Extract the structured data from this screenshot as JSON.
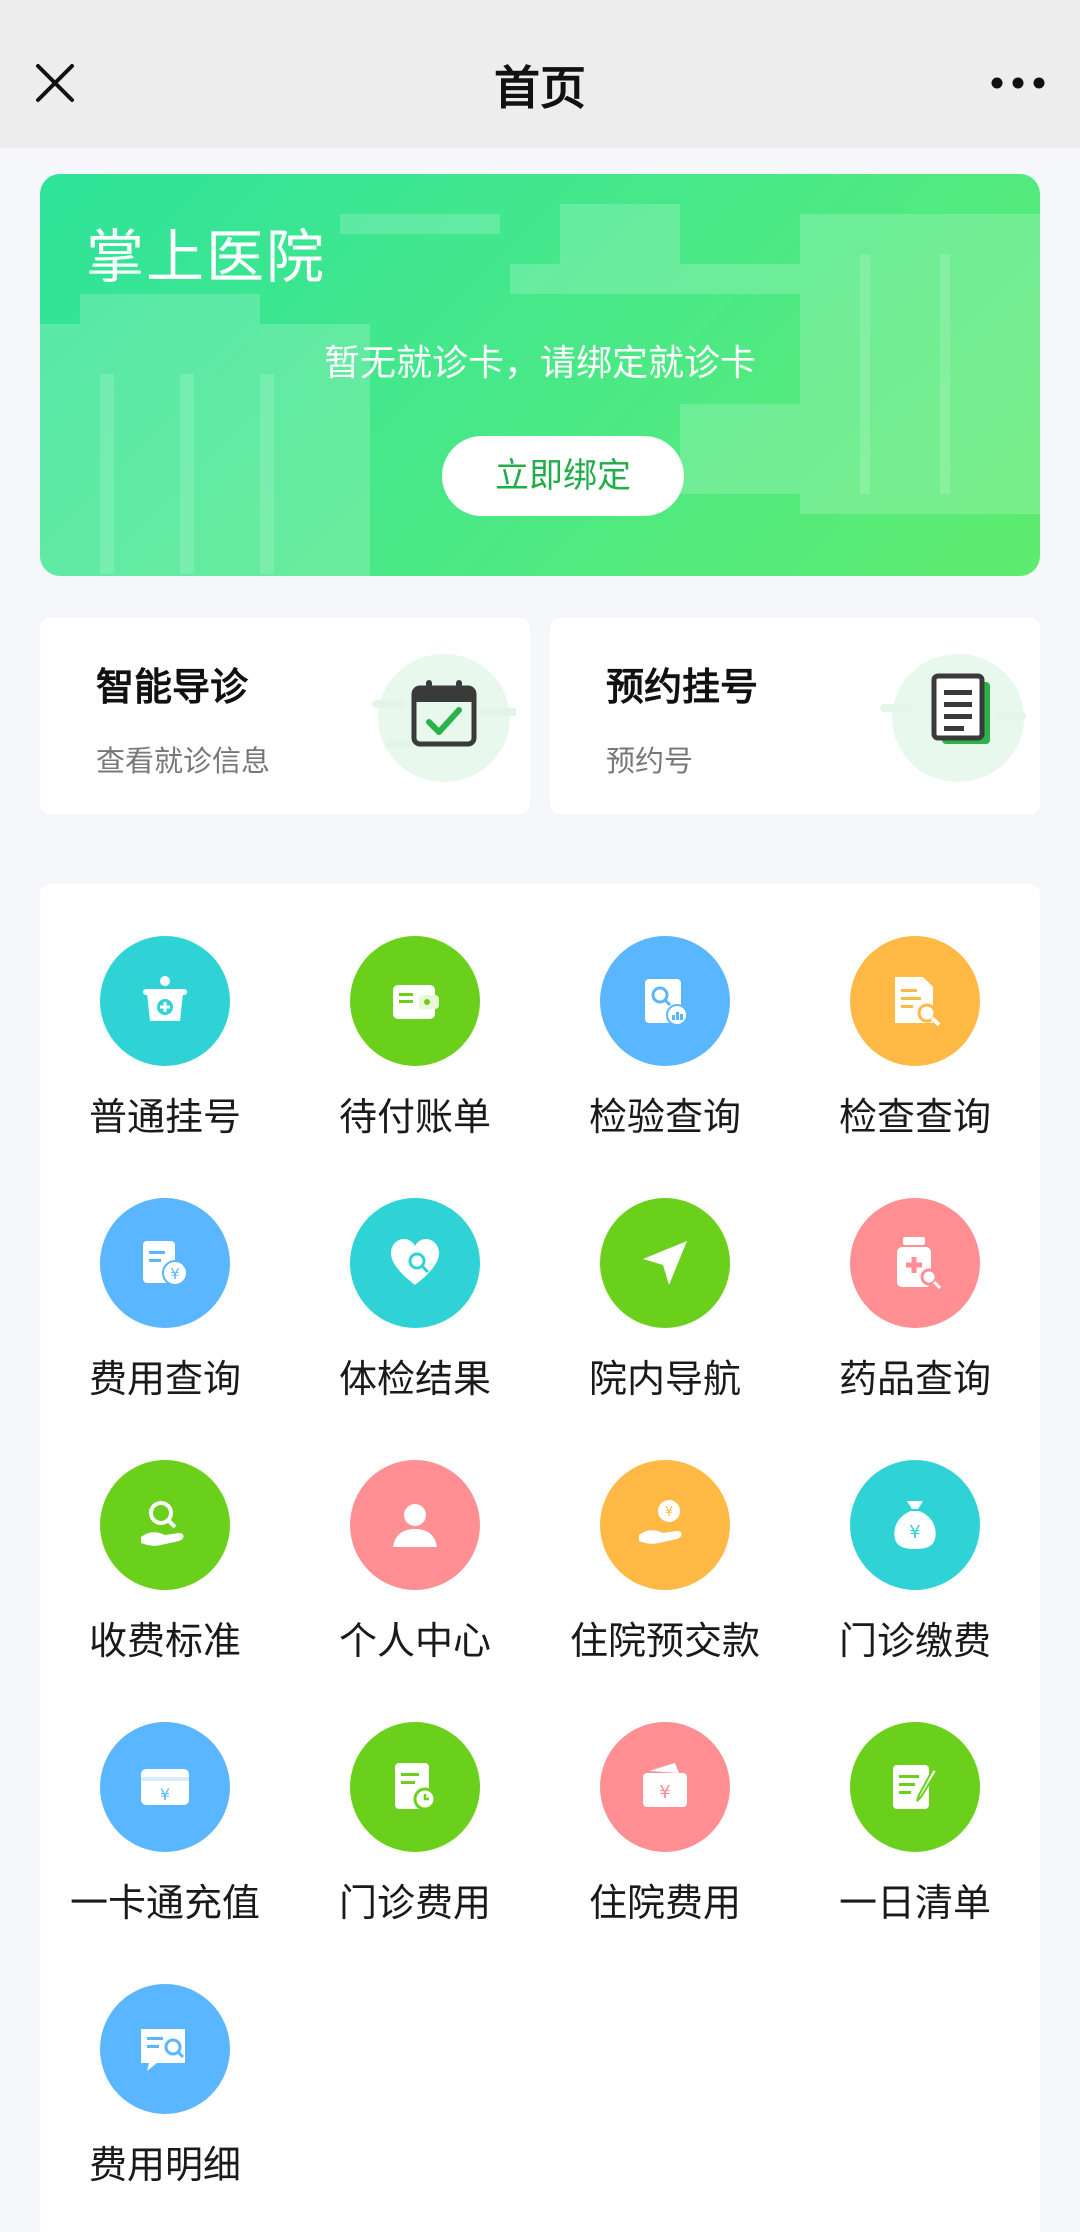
{
  "navbar": {
    "title": "首页"
  },
  "banner": {
    "title": "掌上医院",
    "message": "暂无就诊卡，请绑定就诊卡",
    "bind_button": "立即绑定"
  },
  "quick_cards": [
    {
      "title": "智能导诊",
      "subtitle": "查看就诊信息",
      "icon": "calendar-check-icon"
    },
    {
      "title": "预约挂号",
      "subtitle": "预约号",
      "icon": "document-list-icon"
    }
  ],
  "services": [
    {
      "label": "普通挂号",
      "icon": "registration-desk-icon",
      "color": "#2fd3d6"
    },
    {
      "label": "待付账单",
      "icon": "wallet-icon",
      "color": "#6bd01c"
    },
    {
      "label": "检验查询",
      "icon": "lab-search-icon",
      "color": "#5ab6ff"
    },
    {
      "label": "检查查询",
      "icon": "report-search-icon",
      "color": "#ffb944"
    },
    {
      "label": "费用查询",
      "icon": "fee-document-icon",
      "color": "#5ab6ff"
    },
    {
      "label": "体检结果",
      "icon": "heart-search-icon",
      "color": "#2fd3d6"
    },
    {
      "label": "院内导航",
      "icon": "navigation-arrow-icon",
      "color": "#6bd01c"
    },
    {
      "label": "药品查询",
      "icon": "medicine-bottle-icon",
      "color": "#ff8f93"
    },
    {
      "label": "收费标准",
      "icon": "hand-search-icon",
      "color": "#6bd01c"
    },
    {
      "label": "个人中心",
      "icon": "person-icon",
      "color": "#ff8f93"
    },
    {
      "label": "住院预交款",
      "icon": "hand-coin-icon",
      "color": "#ffb944"
    },
    {
      "label": "门诊缴费",
      "icon": "money-bag-icon",
      "color": "#2fd3d6"
    },
    {
      "label": "一卡通充值",
      "icon": "card-yuan-icon",
      "color": "#5ab6ff"
    },
    {
      "label": "门诊费用",
      "icon": "bill-clock-icon",
      "color": "#6bd01c"
    },
    {
      "label": "住院费用",
      "icon": "wallet-yuan-icon",
      "color": "#ff8f93"
    },
    {
      "label": "一日清单",
      "icon": "edit-list-icon",
      "color": "#6bd01c"
    },
    {
      "label": "费用明细",
      "icon": "detail-search-icon",
      "color": "#5ab6ff"
    }
  ]
}
